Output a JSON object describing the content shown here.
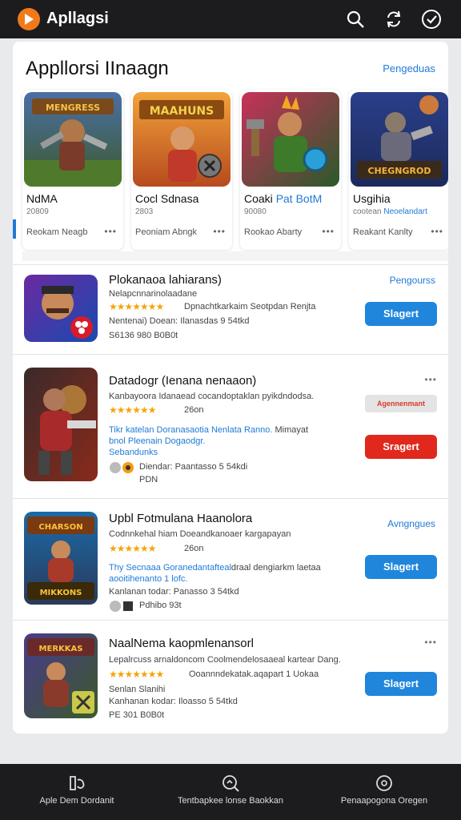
{
  "topbar": {
    "title": "Apllagsi",
    "icons": [
      "search-icon",
      "sync-icon",
      "check-circle-icon"
    ]
  },
  "featured": {
    "title": "Appllorsi IInaagn",
    "link": "Pengeduas",
    "cards": [
      {
        "badge": "MENGRESS",
        "name": "NdMA",
        "sub": "20809",
        "sub_blue": "",
        "author": "Reokam Neagb",
        "icon": "game-art-warrior"
      },
      {
        "badge": "MAAHUNS",
        "name": "Cocl Sdnasa",
        "name_blue": "",
        "sub": "2803",
        "author": "Peoniam Abngk",
        "icon": "game-art-knight"
      },
      {
        "badge": "",
        "name": "Coaki ",
        "name_blue": "Pat BotM",
        "sub": "90080",
        "author": "Rookao Abarty",
        "icon": "game-art-hero"
      },
      {
        "badge": "CHEGNGROD",
        "name": "Usgihia",
        "sub": "cootean ",
        "sub_blue": "Neoelandart",
        "author": "Reakant Kanlty",
        "icon": "game-art-robot"
      }
    ]
  },
  "apps": [
    {
      "title": "Plokanaoa lahiarans)",
      "desc": "Nelapcnnarinolaadane",
      "stars": "★★★★★★★",
      "rating_text": "Dpnachtkarkaim Seotpdan Renjta",
      "meta1": "Nentenai) Doean:  Ilanasdas 9 54tkd",
      "meta2": "S6136  980 B0B0t",
      "link": "Pengourss",
      "button": "Slagert",
      "icon": "game-art-brawler"
    },
    {
      "title": "Datadogr (Ienana nenaaon)",
      "desc": "Kanbayoora Idanaead cocandoptaklan pyikdndodsa.",
      "stars": "★★★★★★",
      "rating_text": "26on",
      "blue1": "Tikr katelan  Doranasaotia Nenlata Ranno.",
      "blue_tail": "Mimayat",
      "blue2": "bnol Pleenain Dogaodgr.",
      "blue3": "Sebandunks",
      "meta1": "Diendar:  Paantasso 5 54kdi",
      "meta2": "PDN",
      "pill": "Agennenmant",
      "button": "Sragert",
      "icon": "game-art-mech"
    },
    {
      "title": "Upbl Fotmulana Haanolora",
      "desc": "Codnnkehal hiam Doeandkanoaer kargapayan",
      "stars": "★★★★★★",
      "rating_text": "26on",
      "blue1": "Thy Secnaaa Goranedantafteal",
      "blue_tail": "draal dengiarkm laetaa",
      "blue2": "aooitihenanto 1 lofc.",
      "meta1": "Kanlanan todar:  Panasso 3 54tkd",
      "meta2": "Pdhibo 93t",
      "link": "Avngngues",
      "button": "Slagert",
      "icon": "game-art-warlord"
    },
    {
      "title": "NaalNema kaopmlenansorl",
      "desc": "Lepalrcuss arnaldoncom Coolmendelosaaeal kartear Dang.",
      "stars": "★★★★★★★",
      "rating_text": "Ooannndekatak.aqapart 1 Uokaa",
      "meta1": "Senlan Slanihi",
      "meta2": "Kanhanan kodar:  Iloasso 5 54tkd",
      "meta3": "PE  301 B0B0t",
      "button": "Slagert",
      "icon": "game-art-fighter"
    }
  ],
  "bottomnav": [
    {
      "label": "Aple Dem Dordanit",
      "icon": "library-icon"
    },
    {
      "label": "Tentbapkee lonse Baokkan",
      "icon": "discover-icon"
    },
    {
      "label": "Penaapogona Oregen",
      "icon": "profile-icon"
    }
  ],
  "colors": {
    "accent": "#1f7ad6",
    "brand": "#f07a1a",
    "danger": "#e0281c",
    "star": "#f4a50b",
    "bar": "#1c1c1e"
  }
}
